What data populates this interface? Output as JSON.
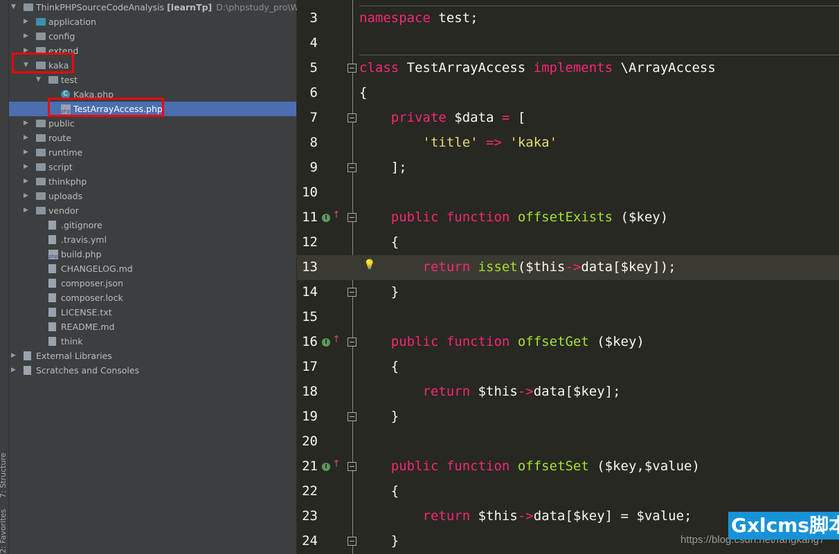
{
  "side_tabs": {
    "structure": "7: Structure",
    "favorites": "2: Favorites"
  },
  "project": {
    "name": "ThinkPHPSourceCodeAnalysis",
    "module": "[learnTp]",
    "path": "D:\\phpstudy_pro\\WWW"
  },
  "tree": [
    {
      "label": "application",
      "type": "folder-blue",
      "depth": 1,
      "expanded": false
    },
    {
      "label": "config",
      "type": "folder",
      "depth": 1,
      "expanded": false
    },
    {
      "label": "extend",
      "type": "folder",
      "depth": 1,
      "expanded": false
    },
    {
      "label": "kaka",
      "type": "folder",
      "depth": 1,
      "expanded": true,
      "highlight": true
    },
    {
      "label": "test",
      "type": "folder",
      "depth": 2,
      "expanded": true
    },
    {
      "label": "Kaka.php",
      "type": "class",
      "depth": 3
    },
    {
      "label": "TestArrayAccess.php",
      "type": "php",
      "depth": 3,
      "selected": true,
      "highlight": true
    },
    {
      "label": "public",
      "type": "folder",
      "depth": 1,
      "expanded": false
    },
    {
      "label": "route",
      "type": "folder",
      "depth": 1,
      "expanded": false
    },
    {
      "label": "runtime",
      "type": "folder",
      "depth": 1,
      "expanded": false
    },
    {
      "label": "script",
      "type": "folder",
      "depth": 1,
      "expanded": false
    },
    {
      "label": "thinkphp",
      "type": "folder",
      "depth": 1,
      "expanded": false
    },
    {
      "label": "uploads",
      "type": "folder",
      "depth": 1,
      "expanded": false
    },
    {
      "label": "vendor",
      "type": "folder",
      "depth": 1,
      "expanded": false
    },
    {
      "label": ".gitignore",
      "type": "file",
      "depth": 2
    },
    {
      "label": ".travis.yml",
      "type": "file",
      "depth": 2
    },
    {
      "label": "build.php",
      "type": "php",
      "depth": 2
    },
    {
      "label": "CHANGELOG.md",
      "type": "file",
      "depth": 2
    },
    {
      "label": "composer.json",
      "type": "file",
      "depth": 2
    },
    {
      "label": "composer.lock",
      "type": "file",
      "depth": 2
    },
    {
      "label": "LICENSE.txt",
      "type": "file",
      "depth": 2
    },
    {
      "label": "README.md",
      "type": "file",
      "depth": 2
    },
    {
      "label": "think",
      "type": "file",
      "depth": 2
    },
    {
      "label": "External Libraries",
      "type": "lib",
      "depth": 0,
      "expanded": false
    },
    {
      "label": "Scratches and Consoles",
      "type": "scratch",
      "depth": 0,
      "expanded": false
    }
  ],
  "code": [
    {
      "n": "3",
      "t": [
        [
          "kw",
          "namespace"
        ],
        [
          "tx",
          " test;"
        ]
      ]
    },
    {
      "n": "4",
      "t": []
    },
    {
      "n": "5",
      "fold": "open",
      "t": [
        [
          "kw",
          "class"
        ],
        [
          "tx",
          " TestArrayAccess "
        ],
        [
          "kw",
          "implements"
        ],
        [
          "tx",
          " \\ArrayAccess"
        ]
      ]
    },
    {
      "n": "6",
      "t": [
        [
          "tx",
          "{"
        ]
      ]
    },
    {
      "n": "7",
      "fold": "open",
      "t": [
        [
          "tx",
          "    "
        ],
        [
          "kw",
          "private"
        ],
        [
          "tx",
          " $data "
        ],
        [
          "kw",
          "="
        ],
        [
          "tx",
          " ["
        ]
      ]
    },
    {
      "n": "8",
      "t": [
        [
          "tx",
          "        "
        ],
        [
          "st",
          "'title'"
        ],
        [
          "tx",
          " "
        ],
        [
          "kw",
          "=>"
        ],
        [
          "tx",
          " "
        ],
        [
          "st",
          "'kaka'"
        ]
      ]
    },
    {
      "n": "9",
      "fold": "close",
      "t": [
        [
          "tx",
          "    ];"
        ]
      ]
    },
    {
      "n": "10",
      "t": []
    },
    {
      "n": "11",
      "fold": "open",
      "impl": true,
      "t": [
        [
          "tx",
          "    "
        ],
        [
          "kw",
          "public"
        ],
        [
          "tx",
          " "
        ],
        [
          "kw",
          "function"
        ],
        [
          "tx",
          " "
        ],
        [
          "fn",
          "offsetExists"
        ],
        [
          "tx",
          " ($key)"
        ]
      ]
    },
    {
      "n": "12",
      "t": [
        [
          "tx",
          "    {"
        ]
      ]
    },
    {
      "n": "13",
      "current": true,
      "bulb": true,
      "t": [
        [
          "tx",
          "        "
        ],
        [
          "kw",
          "return"
        ],
        [
          "tx",
          " "
        ],
        [
          "fn",
          "isset"
        ],
        [
          "tx",
          "($this"
        ],
        [
          "kw",
          "->"
        ],
        [
          "tx",
          "data[$key]);"
        ]
      ]
    },
    {
      "n": "14",
      "fold": "close",
      "t": [
        [
          "tx",
          "    }"
        ]
      ]
    },
    {
      "n": "15",
      "t": []
    },
    {
      "n": "16",
      "fold": "open",
      "impl": true,
      "t": [
        [
          "tx",
          "    "
        ],
        [
          "kw",
          "public"
        ],
        [
          "tx",
          " "
        ],
        [
          "kw",
          "function"
        ],
        [
          "tx",
          " "
        ],
        [
          "fn",
          "offsetGet"
        ],
        [
          "tx",
          " ($key)"
        ]
      ]
    },
    {
      "n": "17",
      "t": [
        [
          "tx",
          "    {"
        ]
      ]
    },
    {
      "n": "18",
      "t": [
        [
          "tx",
          "        "
        ],
        [
          "kw",
          "return"
        ],
        [
          "tx",
          " $this"
        ],
        [
          "kw",
          "->"
        ],
        [
          "tx",
          "data[$key];"
        ]
      ]
    },
    {
      "n": "19",
      "fold": "close",
      "t": [
        [
          "tx",
          "    }"
        ]
      ]
    },
    {
      "n": "20",
      "t": []
    },
    {
      "n": "21",
      "fold": "open",
      "impl": true,
      "t": [
        [
          "tx",
          "    "
        ],
        [
          "kw",
          "public"
        ],
        [
          "tx",
          " "
        ],
        [
          "kw",
          "function"
        ],
        [
          "tx",
          " "
        ],
        [
          "fn",
          "offsetSet"
        ],
        [
          "tx",
          " ($key,$value)"
        ]
      ]
    },
    {
      "n": "22",
      "t": [
        [
          "tx",
          "    {"
        ]
      ]
    },
    {
      "n": "23",
      "t": [
        [
          "tx",
          "        "
        ],
        [
          "kw",
          "return"
        ],
        [
          "tx",
          " $this"
        ],
        [
          "kw",
          "->"
        ],
        [
          "tx",
          "data[$key] = $value;"
        ]
      ]
    },
    {
      "n": "24",
      "fold": "close",
      "t": [
        [
          "tx",
          "    }"
        ]
      ]
    }
  ],
  "watermark": {
    "text": "Gxlcms脚本",
    "url": "https://blog.csdn.net/fangkang7"
  },
  "colors": {
    "keyword": "#f92672",
    "function": "#a6e22e",
    "string": "#e6db74",
    "selection": "#4b6eaf",
    "highlight_box": "#ff0000"
  }
}
